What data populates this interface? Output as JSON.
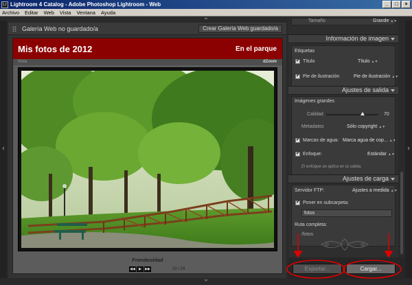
{
  "window": {
    "title": "Lightroom 4 Catalog - Adobe Photoshop Lightroom - Web",
    "app_icon_label": "Lr",
    "controls": [
      "_",
      "□",
      "×"
    ]
  },
  "menu": [
    "Archivo",
    "Editar",
    "Web",
    "Vista",
    "Ventana",
    "Ayuda"
  ],
  "preview": {
    "gallery_title": "Galería Web no guardado/a",
    "create_button": "Crear Galería Web guardado/a",
    "site_title": "Mis fotos de 2012",
    "collection_title": "En el parque",
    "view_label": "Vista",
    "brand": "dZoom",
    "caption": "Frondosidad",
    "counter": "10 / 24",
    "nav": [
      "◀◀",
      "▶",
      "▶▶"
    ]
  },
  "panel": {
    "top_partial_label": "Tamaño",
    "top_partial_value": "Grande",
    "info_section": "Información de imagen",
    "labels_heading": "Etiquetas",
    "title_label": "Título",
    "title_value": "Título",
    "caption_label": "Pie de ilustración",
    "caption_value": "Pie de ilustración",
    "output_section": "Ajustes de salida",
    "large_images": "Imágenes grandes",
    "quality_label": "Calidad",
    "quality_value": "70",
    "quality_fraction": 0.7,
    "metadata_label": "Metadatos",
    "metadata_value": "Sólo copyright",
    "watermark_label": "Marcas de agua:",
    "watermark_value": "Marca agua de cop...",
    "sharpen_label": "Enfoque:",
    "sharpen_value": "Estándar",
    "sharpen_note": "El enfoque se aplica en la salida.",
    "upload_section": "Ajustes de carga",
    "ftp_label": "Servidor FTP:",
    "ftp_value": "Ajustes a medida",
    "subfolder_label": "Poner en subcarpeta:",
    "subfolder_value": "fotos",
    "fullpath_label": "Ruta completa:",
    "fullpath_value": "/fotos"
  },
  "buttons": {
    "export": "Exportar...",
    "upload": "Cargar..."
  },
  "colors": {
    "header_red": "#8b0000",
    "annotation_red": "#e00000",
    "panel_bg": "#2e2e2e"
  }
}
